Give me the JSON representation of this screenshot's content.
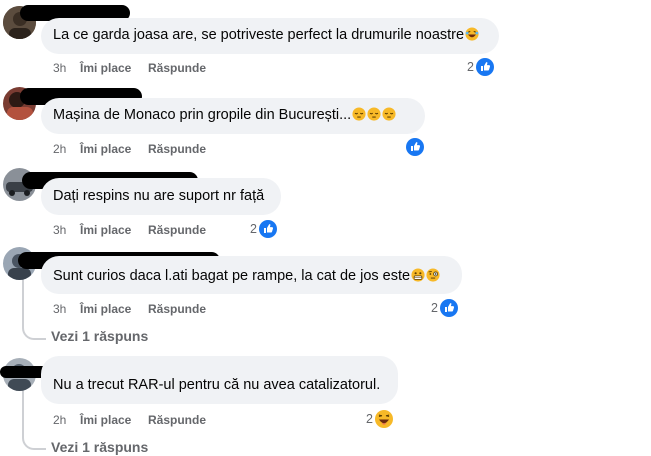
{
  "colors": {
    "bubble": "#f0f2f5",
    "secondary_text": "#65676b",
    "like_blue": "#1877f2",
    "thread_line": "#ced0d4"
  },
  "comments": [
    {
      "text": "La ce garda joasa are, se potriveste perfect la drumurile noastre",
      "emoji": [
        "laughing-emoji"
      ],
      "time": "3h",
      "like": "Îmi place",
      "reply": "Răspunde",
      "reaction_count": "2",
      "reaction_icon": "like-icon"
    },
    {
      "text": "Mașina de Monaco prin gropile din București...",
      "emoji": [
        "sleepy-emoji",
        "sleepy-emoji",
        "sleepy-emoji"
      ],
      "time": "2h",
      "like": "Îmi place",
      "reply": "Răspunde",
      "reaction_count": "",
      "reaction_icon": "like-icon"
    },
    {
      "text": "Dați respins nu are suport nr față",
      "emoji": [],
      "time": "3h",
      "like": "Îmi place",
      "reply": "Răspunde",
      "reaction_count": "2",
      "reaction_icon": "like-icon"
    },
    {
      "text": "Sunt curios daca l.ati bagat pe rampe, la cat de jos este",
      "emoji": [
        "grimacing-emoji",
        "monocle-emoji"
      ],
      "time": "3h",
      "like": "Îmi place",
      "reply": "Răspunde",
      "reaction_count": "2",
      "reaction_icon": "like-icon",
      "view_replies": "Vezi 1 răspuns"
    },
    {
      "text": "Nu a trecut RAR-ul pentru că nu avea catalizatorul.",
      "emoji": [],
      "time": "2h",
      "like": "Îmi place",
      "reply": "Răspunde",
      "reaction_count": "2",
      "reaction_icon": "haha-icon",
      "view_replies": "Vezi 1 răspuns"
    }
  ]
}
